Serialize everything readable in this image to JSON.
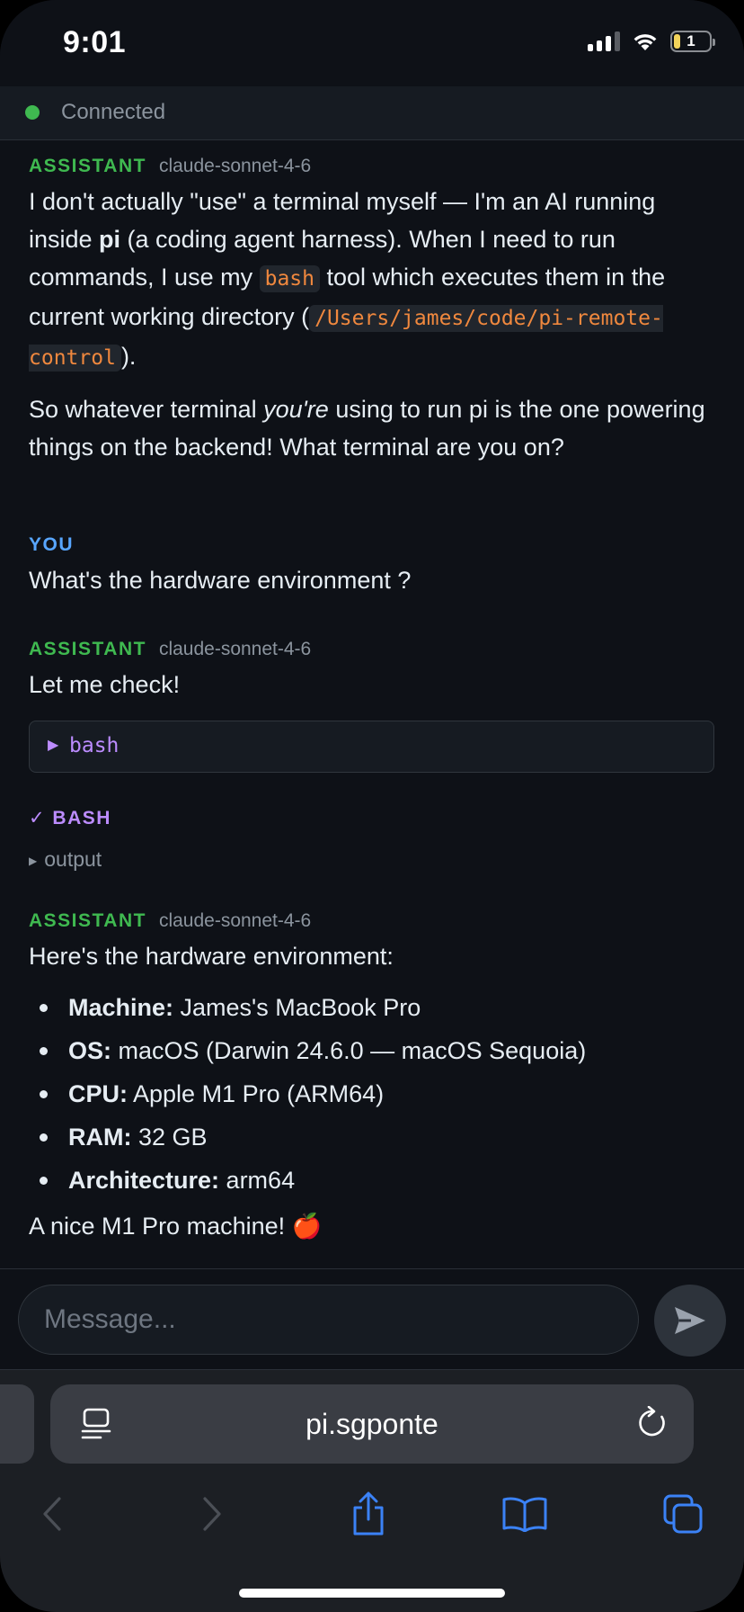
{
  "status_bar": {
    "time": "9:01",
    "battery": "1"
  },
  "connection": {
    "status": "Connected",
    "color": "#3fb950"
  },
  "messages": {
    "m1": {
      "role": "ASSISTANT",
      "model": "claude-sonnet-4-6",
      "p1": {
        "t1": "I don't actually \"use\" a terminal myself — I'm an AI running inside ",
        "b1": "pi",
        "t2": " (a coding agent harness). When I need to run commands, I use my ",
        "c1": "bash",
        "t3": " tool which executes them in the current working directory (",
        "c2": "/Users/james/code/pi-remote-control",
        "t4": ")."
      },
      "p2": {
        "t1": "So whatever terminal ",
        "em": "you're",
        "t2": " using to run pi is the one powering things on the backend! What terminal are you on?"
      }
    },
    "m2": {
      "role": "YOU",
      "text": "What's the hardware environment ?"
    },
    "m3": {
      "role": "ASSISTANT",
      "model": "claude-sonnet-4-6",
      "text": "Let me check!",
      "tool_call": {
        "label": "bash"
      },
      "tool_result": {
        "label": "✓ BASH",
        "output_label": "output"
      }
    },
    "m4": {
      "role": "ASSISTANT",
      "model": "claude-sonnet-4-6",
      "intro": "Here's the hardware environment:",
      "items": [
        {
          "key": "Machine:",
          "value": " James's MacBook Pro"
        },
        {
          "key": "OS:",
          "value": " macOS (Darwin 24.6.0 — macOS Sequoia)"
        },
        {
          "key": "CPU:",
          "value": " Apple M1 Pro (ARM64)"
        },
        {
          "key": "RAM:",
          "value": " 32 GB"
        },
        {
          "key": "Architecture:",
          "value": " arm64"
        }
      ],
      "outro": "A nice M1 Pro machine! 🍎"
    }
  },
  "composer": {
    "placeholder": "Message..."
  },
  "browser": {
    "url": "pi.sgponte"
  },
  "icons": {
    "send": "send-icon",
    "reader": "reader-mode-icon",
    "reload": "reload-icon",
    "back": "chevron-left-icon",
    "forward": "chevron-right-icon",
    "share": "share-icon",
    "bookmarks": "bookmarks-icon",
    "tabs": "tabs-icon"
  },
  "colors": {
    "background": "#0e1117",
    "assistant": "#3fb950",
    "user": "#58a6ff",
    "tool": "#bc8cff",
    "inline_code": "#f0883e",
    "link_blue": "#3b82f6"
  }
}
